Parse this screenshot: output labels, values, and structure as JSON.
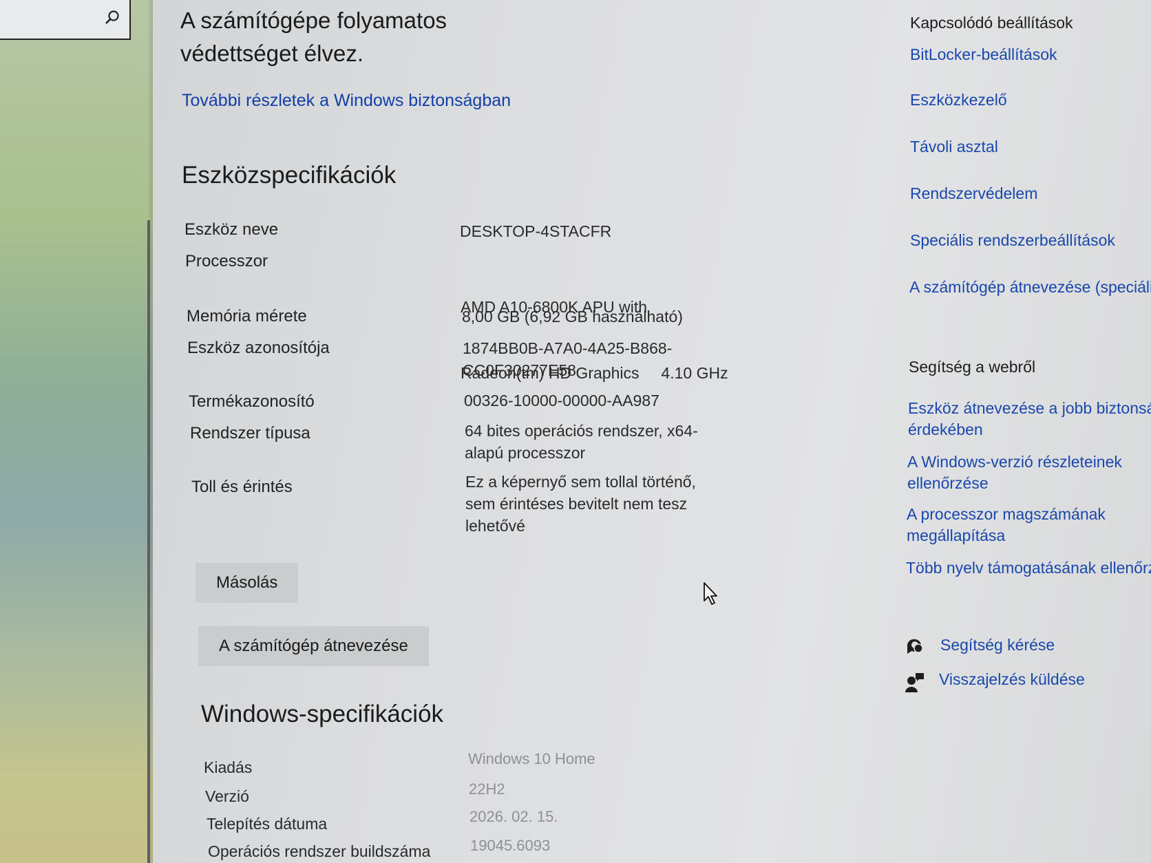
{
  "search": {
    "icon": "search-icon"
  },
  "protection": {
    "line1": "A számítógépe folyamatos",
    "line2": "védettséget élvez.",
    "more_link": "További részletek a Windows biztonságban"
  },
  "device_specs": {
    "title": "Eszközspecifikációk",
    "rows": [
      {
        "label": "Eszköz neve",
        "value_lines": [
          "DESKTOP-4STACFR"
        ]
      },
      {
        "label": "Processzor",
        "value_lines": [
          "AMD A10-6800K APU with",
          "Radeon(tm) HD Graphics     4.10 GHz"
        ]
      },
      {
        "label": "Memória mérete",
        "value_lines": [
          "8,00 GB (6,92 GB használható)"
        ]
      },
      {
        "label": "Eszköz azonosítója",
        "value_lines": [
          "1874BB0B-A7A0-4A25-B868-",
          "CC0F30277E58"
        ]
      },
      {
        "label": "Termékazonosító",
        "value_lines": [
          "00326-10000-00000-AA987"
        ]
      },
      {
        "label": "Rendszer típusa",
        "value_lines": [
          "64 bites operációs rendszer, x64-",
          "alapú processzor"
        ]
      },
      {
        "label": "Toll és érintés",
        "value_lines": [
          "Ez a képernyő sem tollal történő,",
          "sem érintéses bevitelt nem tesz",
          "lehetővé"
        ]
      }
    ],
    "copy_button": "Másolás",
    "rename_button": "A számítógép átnevezése"
  },
  "windows_specs": {
    "title": "Windows-specifikációk",
    "rows": [
      {
        "label": "Kiadás",
        "value": "Windows 10 Home"
      },
      {
        "label": "Verzió",
        "value": "22H2"
      },
      {
        "label": "Telepítés dátuma",
        "value": "2026. 02. 15."
      },
      {
        "label": "Operációs rendszer buildszáma",
        "value": "19045.6093"
      }
    ]
  },
  "related": {
    "title": "Kapcsolódó beállítások",
    "links": [
      "BitLocker-beállítások",
      "Eszközkezelő",
      "Távoli asztal",
      "Rendszervédelem",
      "Speciális rendszerbeállítások",
      "A számítógép átnevezése (speciális)"
    ]
  },
  "web_help": {
    "title": "Segítség a webről",
    "links": [
      {
        "lines": [
          "Eszköz átnevezése a jobb biztonság",
          "érdekében"
        ]
      },
      {
        "lines": [
          "A Windows-verzió részleteinek",
          "ellenőrzése"
        ]
      },
      {
        "lines": [
          "A processzor magszámának",
          "megállapítása"
        ]
      },
      {
        "lines": [
          "Több nyelv támogatásának ellenőrzése"
        ]
      }
    ]
  },
  "support": {
    "get_help": "Segítség kérése",
    "feedback": "Visszajelzés küldése"
  },
  "colors": {
    "link": "#1a47ad",
    "text": "#1c1c1c",
    "button": "#cbcccd"
  }
}
